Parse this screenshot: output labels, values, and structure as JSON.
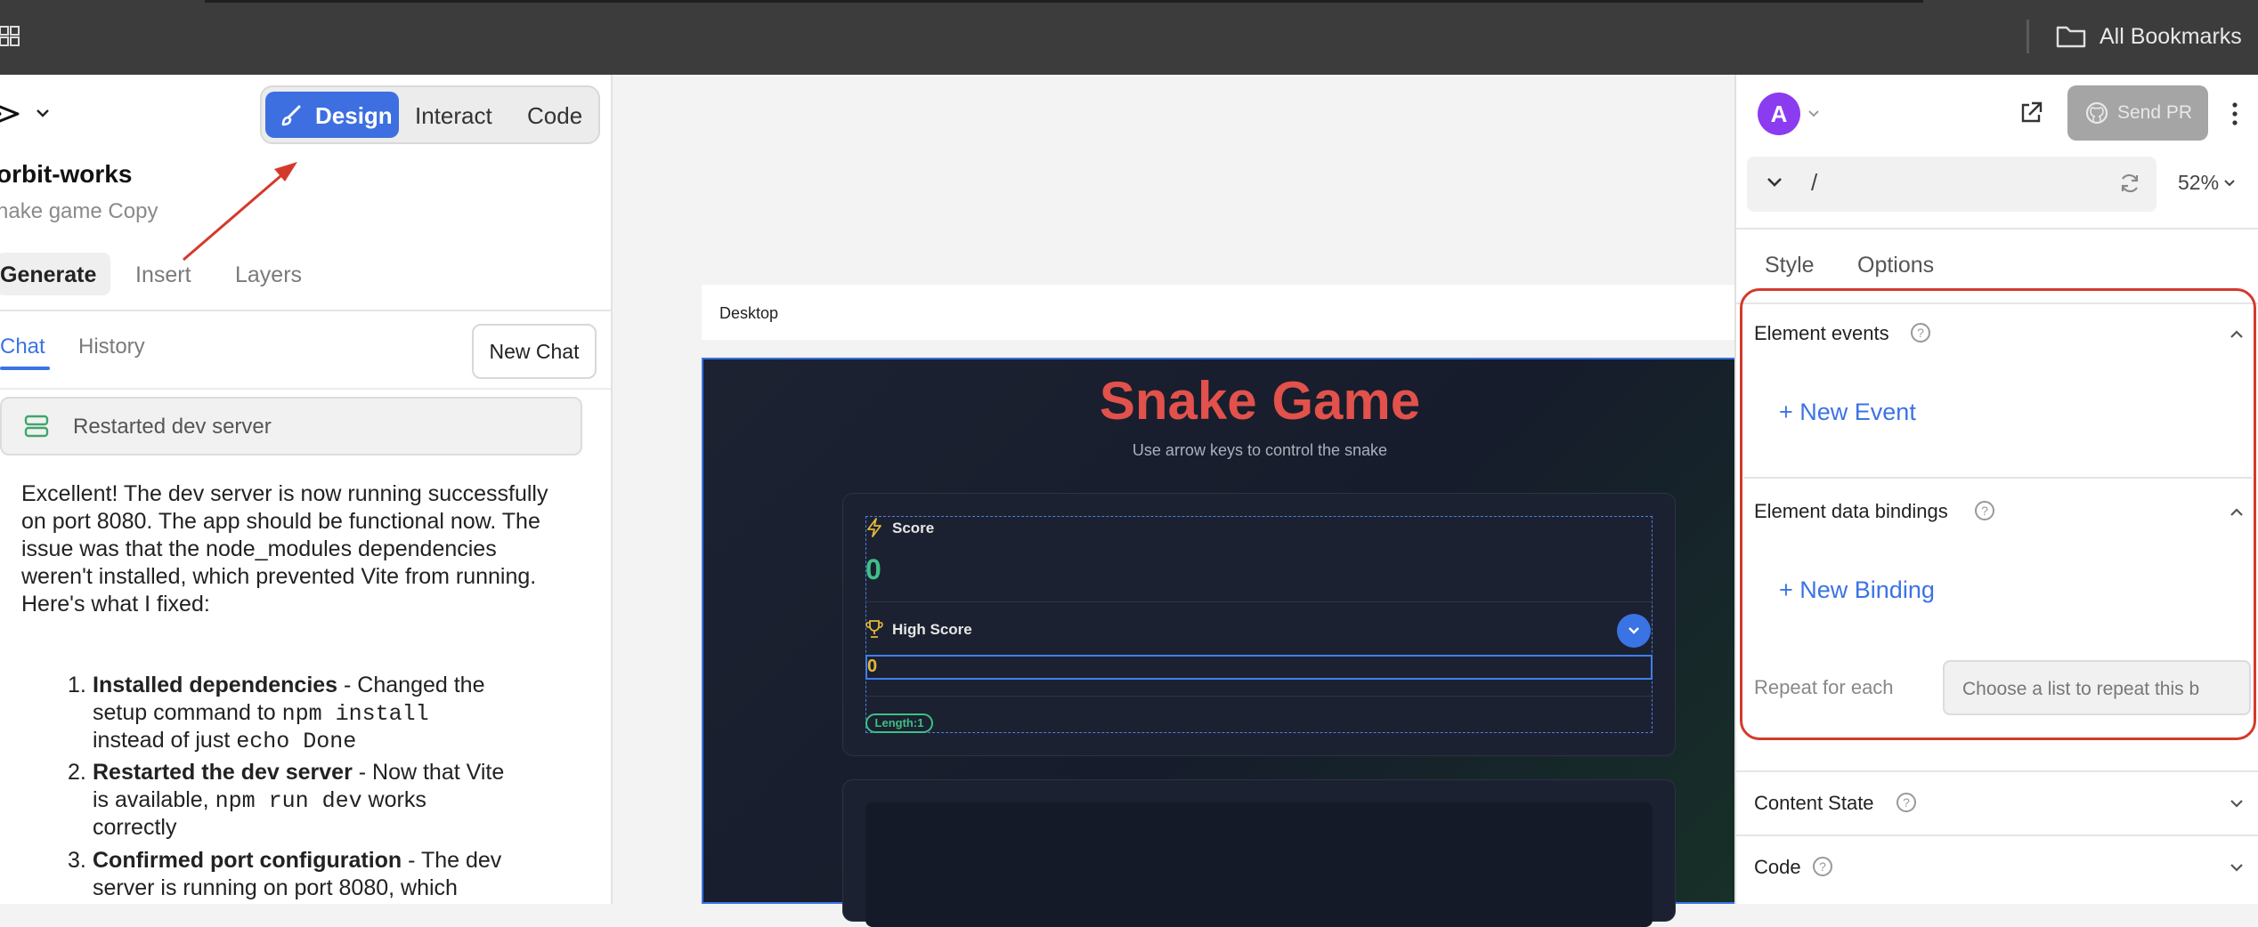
{
  "browser": {
    "bookmarks_label": "All Bookmarks"
  },
  "left_panel": {
    "modes": [
      "Design",
      "Interact",
      "Code"
    ],
    "project_title": "orbit-works",
    "project_subtitle": "nake game Copy",
    "tabs": [
      "Generate",
      "Insert",
      "Layers"
    ],
    "chat_tabs": [
      "Chat",
      "History"
    ],
    "new_chat_label": "New Chat",
    "status_text": "Restarted dev server",
    "message_intro": "Excellent! The dev server is now running successfully on port 8080. The app should be functional now. The issue was that the node_modules dependencies weren't installed, which prevented Vite from running. Here's what I fixed:",
    "list": [
      {
        "num": "1.",
        "bold": "Installed dependencies",
        "l1": " - Changed the",
        "l2a": "setup command to ",
        "l2code": "npm install",
        "l3a": "instead of just ",
        "l3code": "echo Done"
      },
      {
        "num": "2.",
        "bold": "Restarted the dev server",
        "l1": " - Now that Vite",
        "l2a": "is available, ",
        "l2code": "npm run dev",
        "l2b": " works",
        "l3a": "correctly"
      },
      {
        "num": "3.",
        "bold": "Confirmed port configuration",
        "l1": " - The dev",
        "l2a": "server is running on port 8080, which"
      }
    ]
  },
  "canvas": {
    "frame_label": "Desktop",
    "game_title": "Snake Game",
    "game_subtitle": "Use arrow keys to control the snake",
    "score_label": "Score",
    "score_value": "0",
    "high_score_label": "High Score",
    "high_score_value": "0",
    "length_badge": "Length:1"
  },
  "right_panel": {
    "avatar_letter": "A",
    "send_pr_label": "Send PR",
    "route": "/",
    "zoom": "52%",
    "tabs": [
      "Style",
      "Options"
    ],
    "element_events_title": "Element events",
    "new_event_label": "+ New Event",
    "element_bindings_title": "Element data bindings",
    "new_binding_label": "+ New Binding",
    "repeat_label": "Repeat for each",
    "repeat_placeholder": "Choose a list to repeat this b",
    "content_state_title": "Content State",
    "code_title": "Code",
    "help_glyph": "?"
  },
  "colors": {
    "accent": "#3d6fe0",
    "avatar": "#8b3cf0",
    "title_red": "#e2514b",
    "score_green": "#3fbf86",
    "highscore_gold": "#e4b83a",
    "annotation_red": "#d43a2c"
  },
  "icons": [
    "apps-grid-icon",
    "folder-icon",
    "logo-icon",
    "chevron-down-icon",
    "brush-icon",
    "server-icon",
    "lightning-icon",
    "trophy-icon",
    "external-link-icon",
    "github-icon",
    "more-vertical-icon",
    "refresh-icon",
    "help-icon",
    "chevron-up-icon"
  ]
}
